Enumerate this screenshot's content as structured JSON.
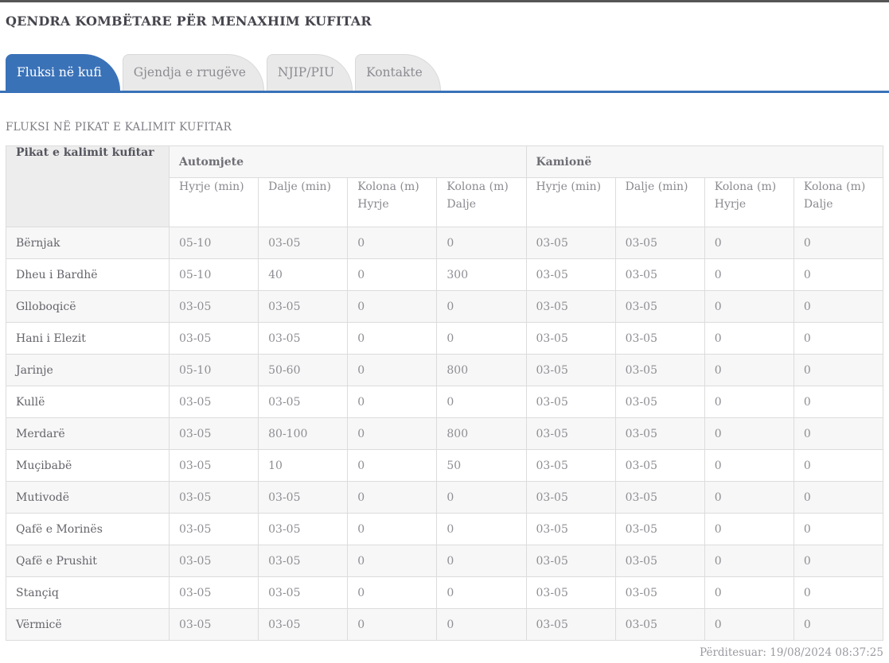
{
  "header": {
    "title": "QENDRA KOMBËTARE PËR MENAXHIM KUFITAR"
  },
  "tabs": [
    {
      "label": "Fluksi në kufi",
      "active": true
    },
    {
      "label": "Gjendja e rrugëve",
      "active": false
    },
    {
      "label": "NJIP/PIU",
      "active": false
    },
    {
      "label": "Kontakte",
      "active": false
    }
  ],
  "main": {
    "section_title": "FLUKSI NË PIKAT E KALIMIT KUFITAR",
    "updated": "Përditesuar: 19/08/2024 08:37:25"
  },
  "table": {
    "corner_header": "Pikat e kalimit kufitar",
    "groups": [
      {
        "label": "Automjete",
        "columns": [
          "Hyrje (min)",
          "Dalje (min)",
          "Kolona (m) Hyrje",
          "Kolona (m) Dalje"
        ]
      },
      {
        "label": "Kamionë",
        "columns": [
          "Hyrje (min)",
          "Dalje (min)",
          "Kolona (m) Hyrje",
          "Kolona (m) Dalje"
        ]
      }
    ],
    "rows": [
      {
        "name": "Bërnjak",
        "values": [
          "05-10",
          "03-05",
          "0",
          "0",
          "03-05",
          "03-05",
          "0",
          "0"
        ]
      },
      {
        "name": "Dheu i Bardhë",
        "values": [
          "05-10",
          "40",
          "0",
          "300",
          "03-05",
          "03-05",
          "0",
          "0"
        ]
      },
      {
        "name": "Glloboqicë",
        "values": [
          "03-05",
          "03-05",
          "0",
          "0",
          "03-05",
          "03-05",
          "0",
          "0"
        ]
      },
      {
        "name": "Hani i Elezit",
        "values": [
          "03-05",
          "03-05",
          "0",
          "0",
          "03-05",
          "03-05",
          "0",
          "0"
        ]
      },
      {
        "name": "Jarinje",
        "values": [
          "05-10",
          "50-60",
          "0",
          "800",
          "03-05",
          "03-05",
          "0",
          "0"
        ]
      },
      {
        "name": "Kullë",
        "values": [
          "03-05",
          "03-05",
          "0",
          "0",
          "03-05",
          "03-05",
          "0",
          "0"
        ]
      },
      {
        "name": "Merdarë",
        "values": [
          "03-05",
          "80-100",
          "0",
          "800",
          "03-05",
          "03-05",
          "0",
          "0"
        ]
      },
      {
        "name": "Muçibabë",
        "values": [
          "03-05",
          "10",
          "0",
          "50",
          "03-05",
          "03-05",
          "0",
          "0"
        ]
      },
      {
        "name": "Mutivodë",
        "values": [
          "03-05",
          "03-05",
          "0",
          "0",
          "03-05",
          "03-05",
          "0",
          "0"
        ]
      },
      {
        "name": "Qafë e Morinës",
        "values": [
          "03-05",
          "03-05",
          "0",
          "0",
          "03-05",
          "03-05",
          "0",
          "0"
        ]
      },
      {
        "name": "Qafë e Prushit",
        "values": [
          "03-05",
          "03-05",
          "0",
          "0",
          "03-05",
          "03-05",
          "0",
          "0"
        ]
      },
      {
        "name": "Stançiq",
        "values": [
          "03-05",
          "03-05",
          "0",
          "0",
          "03-05",
          "03-05",
          "0",
          "0"
        ]
      },
      {
        "name": "Vërmicë",
        "values": [
          "03-05",
          "03-05",
          "0",
          "0",
          "03-05",
          "03-05",
          "0",
          "0"
        ]
      }
    ]
  },
  "colors": {
    "accent_blue": "#3a72b8",
    "top_bar_gray": "#565656",
    "tab_inactive_bg": "#e9e9e9",
    "table_border": "#dcdcdc",
    "stripe_row_bg": "#f7f7f7",
    "corner_header_bg": "#ededed"
  }
}
